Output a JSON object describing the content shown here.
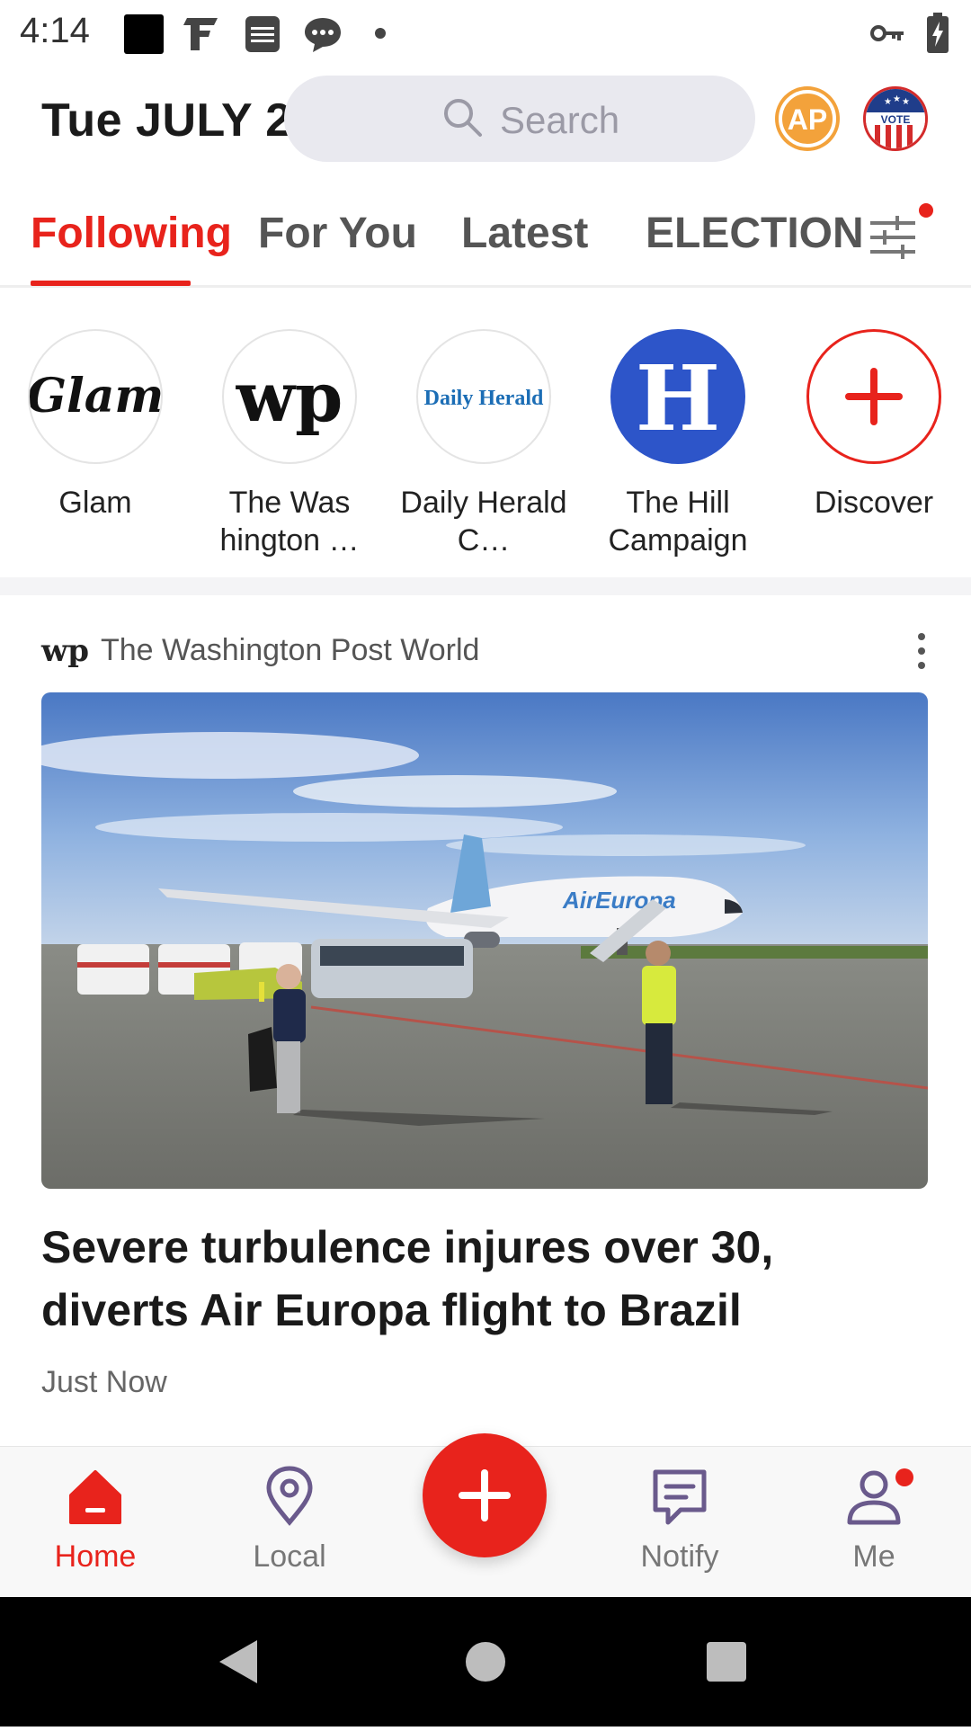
{
  "status_bar": {
    "time": "4:14",
    "notification_icons": [
      "app-black-square-icon",
      "f-logo-icon",
      "local-news-icon",
      "chat-bubble-icon",
      "dot-icon"
    ],
    "right_icons": [
      "vpn-key-icon",
      "battery-charging-icon"
    ]
  },
  "header": {
    "date": "Tue JULY 2",
    "search_placeholder": "Search",
    "ap_badge": "AP",
    "vote_badge": "VOTE"
  },
  "tabs": [
    {
      "label": "Following",
      "active": true
    },
    {
      "label": "For You",
      "active": false
    },
    {
      "label": "Latest",
      "active": false
    },
    {
      "label": "ELECTION",
      "active": false
    }
  ],
  "sources": [
    {
      "name": "Glam",
      "logo_text": "Glam"
    },
    {
      "name": "The Was hington …",
      "logo_text": "wp"
    },
    {
      "name": "Daily Herald C…",
      "logo_text": "Daily Herald"
    },
    {
      "name": "The Hill Campaign",
      "logo_text": "H"
    },
    {
      "name": "Discover",
      "logo_text": "+"
    }
  ],
  "article": {
    "source_logo": "wp",
    "source": "The Washington Post World",
    "headline": "Severe turbulence injures over 30, diverts Air Europa flight to Brazil",
    "timestamp": "Just Now",
    "image_text": "AirEuropa"
  },
  "bottom_nav": {
    "items": [
      {
        "label": "Home",
        "icon": "home-icon",
        "active": true
      },
      {
        "label": "Local",
        "icon": "location-pin-icon",
        "active": false
      },
      {
        "label": "Notify",
        "icon": "message-icon",
        "active": false
      },
      {
        "label": "Me",
        "icon": "person-icon",
        "active": false
      }
    ],
    "fab_icon": "plus-icon"
  },
  "colors": {
    "accent": "#e8231c",
    "tab_inactive": "#555555",
    "hill_blue": "#2d55c9",
    "ap_orange": "#f3a23b"
  }
}
